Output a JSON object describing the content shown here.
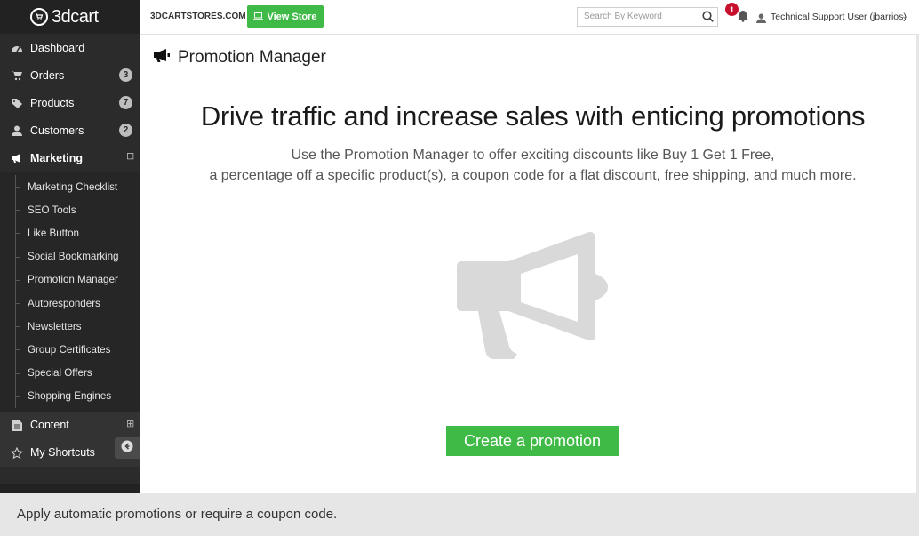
{
  "sidebar": {
    "logo_text": "3dcart",
    "items": [
      {
        "label": "Dashboard",
        "icon": "dashboard-icon"
      },
      {
        "label": "Orders",
        "icon": "cart-icon",
        "badge": "3"
      },
      {
        "label": "Products",
        "icon": "tag-icon",
        "badge": "7"
      },
      {
        "label": "Customers",
        "icon": "user-icon",
        "badge": "2"
      },
      {
        "label": "Marketing",
        "icon": "megaphone-icon",
        "toggle": "⊟"
      }
    ],
    "marketing_submenu": [
      "Marketing Checklist",
      "SEO Tools",
      "Like Button",
      "Social Bookmarking",
      "Promotion Manager",
      "Autoresponders",
      "Newsletters",
      "Group Certificates",
      "Special Offers",
      "Shopping Engines"
    ],
    "lower_items": [
      {
        "label": "Content",
        "icon": "document-icon",
        "toggle": "⊞"
      },
      {
        "label": "My Shortcuts",
        "icon": "star-icon"
      }
    ]
  },
  "topbar": {
    "store_name": "3DCARTSTORES.COM",
    "view_store_label": "View Store",
    "search_placeholder": "Search By Keyword",
    "notification_count": "1",
    "user_label": "Technical Support User (jbarrios)"
  },
  "main": {
    "page_title": "Promotion Manager",
    "headline": "Drive traffic and increase sales with enticing promotions",
    "desc_line1": "Use the Promotion Manager to offer exciting discounts like Buy 1 Get 1 Free,",
    "desc_line2": "a percentage off a specific product(s), a coupon code for a flat discount, free shipping, and much more.",
    "create_button": "Create a promotion"
  },
  "caption": "Apply automatic promotions or require a coupon code.",
  "colors": {
    "accent_green": "#3fba46",
    "sidebar_bg": "#2b2b2b",
    "notif_red": "#c8102e"
  }
}
